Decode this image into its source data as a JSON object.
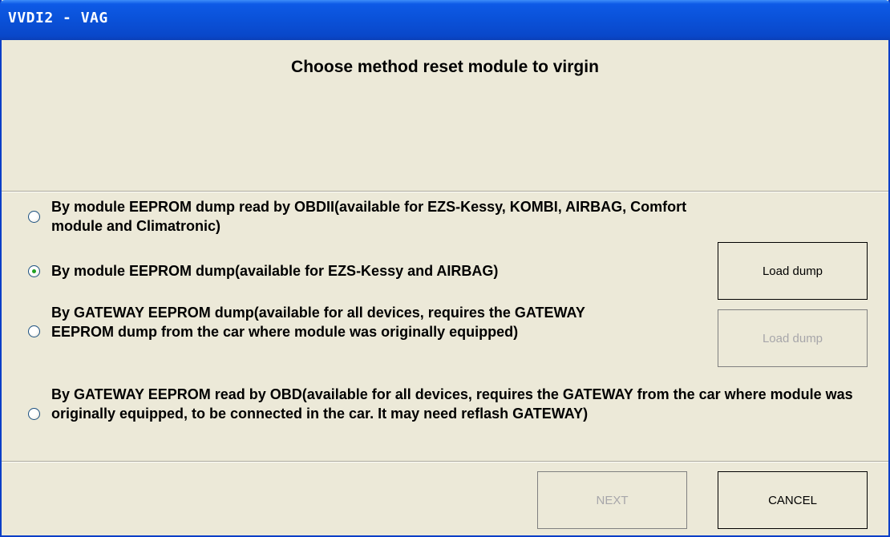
{
  "window": {
    "title": "VVDI2 - VAG"
  },
  "heading": "Choose method reset module to virgin",
  "options": [
    {
      "label": "By module EEPROM dump read by OBDII(available for EZS-Kessy, KOMBI, AIRBAG, Comfort module and Climatronic)",
      "selected": false
    },
    {
      "label": "By module EEPROM dump(available for EZS-Kessy and AIRBAG)",
      "selected": true
    },
    {
      "label": "By GATEWAY EEPROM dump(available for all devices, requires the GATEWAY EEPROM dump from the car where module was originally equipped)",
      "selected": false
    },
    {
      "label": "By GATEWAY EEPROM read by OBD(available for all devices, requires the GATEWAY from the car where module was originally equipped, to be connected in the car. It may need reflash GATEWAY)",
      "selected": false
    }
  ],
  "buttons": {
    "load_dump_1": {
      "label": "Load dump",
      "enabled": true
    },
    "load_dump_2": {
      "label": "Load dump",
      "enabled": false
    },
    "next": {
      "label": "NEXT",
      "enabled": false
    },
    "cancel": {
      "label": "CANCEL",
      "enabled": true
    }
  },
  "colors": {
    "titlebar": "#0a51d8",
    "background": "#ece9d8",
    "radio_dot": "#21a121",
    "disabled_text": "#a7a6aa"
  }
}
